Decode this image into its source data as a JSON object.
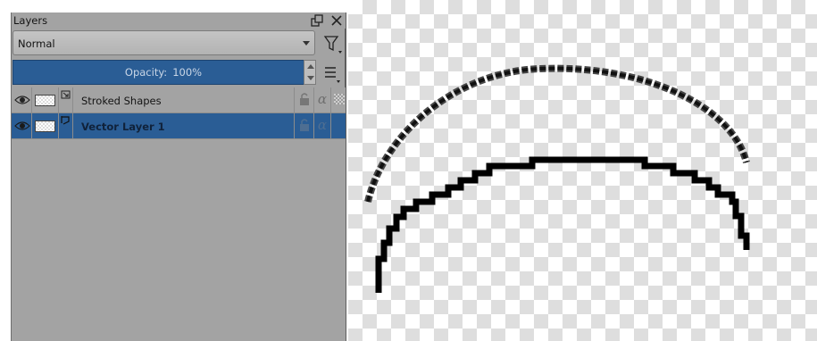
{
  "docker": {
    "title": "Layers",
    "blend_mode": "Normal",
    "opacity": {
      "label": "Opacity:",
      "value": "100%"
    }
  },
  "layers": [
    {
      "name": "Stroked Shapes",
      "visible": true,
      "selected": false,
      "type_icon": "shape-layer-icon"
    },
    {
      "name": "Vector Layer 1",
      "visible": true,
      "selected": true,
      "type_icon": "vector-layer-icon"
    }
  ],
  "colors": {
    "selection": "#2a5d95",
    "panel": "#a3a3a3"
  }
}
